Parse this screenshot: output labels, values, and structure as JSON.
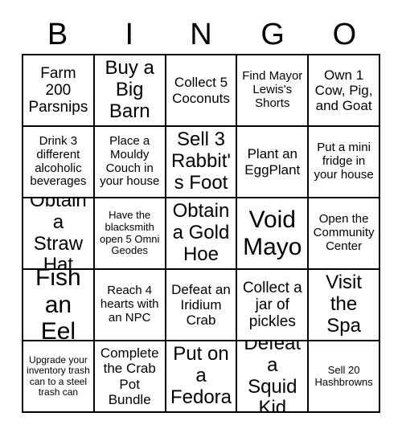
{
  "card": {
    "header_letters": [
      "B",
      "I",
      "N",
      "G",
      "O"
    ],
    "rows": [
      [
        {
          "text": "Farm 200 Parsnips",
          "size": "fs-lg"
        },
        {
          "text": "Buy a Big Barn",
          "size": "fs-xl"
        },
        {
          "text": "Collect 5 Coconuts",
          "size": "fs-md"
        },
        {
          "text": "Find Mayor Lewis's Shorts",
          "size": "fs-sm"
        },
        {
          "text": "Own 1 Cow, Pig, and Goat",
          "size": "fs-md"
        }
      ],
      [
        {
          "text": "Drink 3 different alcoholic beverages",
          "size": "fs-sm"
        },
        {
          "text": "Place a Mouldy Couch in your house",
          "size": "fs-sm"
        },
        {
          "text": "Sell 3 Rabbit's Foot",
          "size": "fs-xl"
        },
        {
          "text": "Plant an EggPlant",
          "size": "fs-md"
        },
        {
          "text": "Put a mini fridge in your house",
          "size": "fs-sm"
        }
      ],
      [
        {
          "text": "Obtain a Straw Hat",
          "size": "fs-xl"
        },
        {
          "text": "Have the blacksmith open 5 Omni Geodes",
          "size": "fs-xs"
        },
        {
          "text": "Obtain a Gold Hoe",
          "size": "fs-xl"
        },
        {
          "text": "Void Mayo",
          "size": "fs-xxl"
        },
        {
          "text": "Open the Community Center",
          "size": "fs-sm"
        }
      ],
      [
        {
          "text": "Fish an Eel",
          "size": "fs-xxl"
        },
        {
          "text": "Reach 4 hearts with an NPC",
          "size": "fs-sm"
        },
        {
          "text": "Defeat an Iridium Crab",
          "size": "fs-md"
        },
        {
          "text": "Collect a jar of pickles",
          "size": "fs-lg"
        },
        {
          "text": "Visit the Spa",
          "size": "fs-xl"
        }
      ],
      [
        {
          "text": "Upgrade your inventory trash can to a steel trash can",
          "size": "fs-xxs"
        },
        {
          "text": "Complete the Crab Pot Bundle",
          "size": "fs-md"
        },
        {
          "text": "Put on a Fedora",
          "size": "fs-xl"
        },
        {
          "text": "Defeat a Squid Kid",
          "size": "fs-xl"
        },
        {
          "text": "Sell 20 Hashbrowns",
          "size": "fs-xs"
        }
      ]
    ]
  }
}
